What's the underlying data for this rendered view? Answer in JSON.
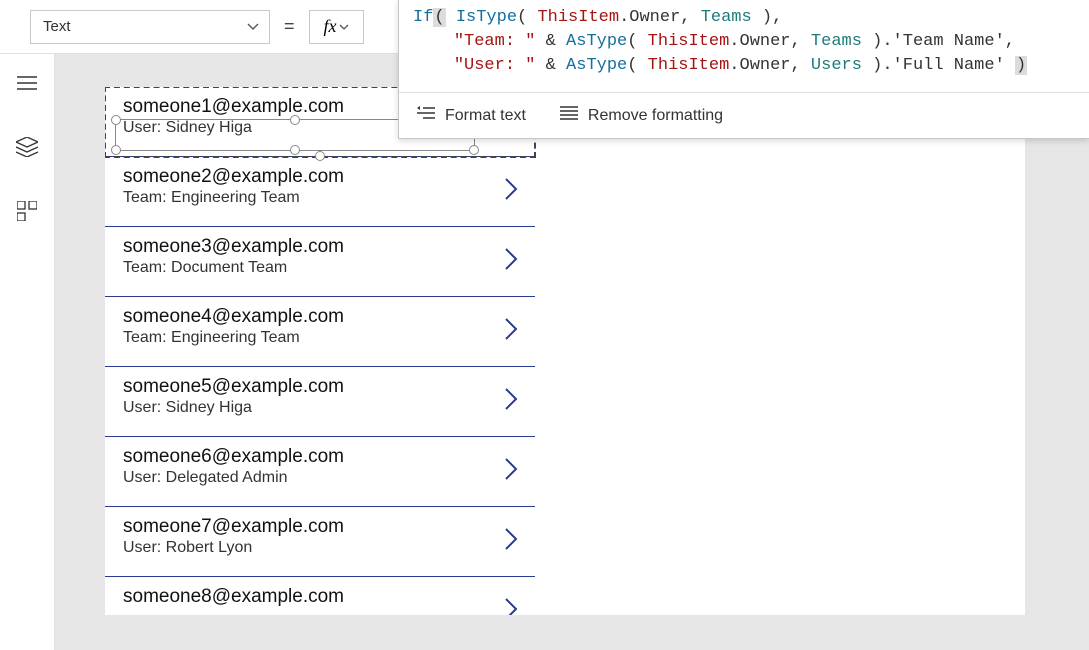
{
  "topbar": {
    "property": "Text",
    "equals": "=",
    "fx": "fx"
  },
  "formula": {
    "format_label": "Format text",
    "remove_label": "Remove formatting",
    "tokens": [
      {
        "t": "If",
        "c": "fn"
      },
      {
        "t": "(",
        "c": "par"
      },
      {
        "t": " ",
        "c": ""
      },
      {
        "t": "IsType",
        "c": "fn"
      },
      {
        "t": "( ",
        "c": ""
      },
      {
        "t": "ThisItem",
        "c": "kw"
      },
      {
        "t": ".",
        "c": ""
      },
      {
        "t": "Owner",
        "c": ""
      },
      {
        "t": ", ",
        "c": ""
      },
      {
        "t": "Teams",
        "c": "id"
      },
      {
        "t": " ),",
        "c": ""
      },
      {
        "t": "\n    ",
        "c": ""
      },
      {
        "t": "\"Team: \"",
        "c": "str"
      },
      {
        "t": " & ",
        "c": ""
      },
      {
        "t": "AsType",
        "c": "fn"
      },
      {
        "t": "( ",
        "c": ""
      },
      {
        "t": "ThisItem",
        "c": "kw"
      },
      {
        "t": ".",
        "c": ""
      },
      {
        "t": "Owner",
        "c": ""
      },
      {
        "t": ", ",
        "c": ""
      },
      {
        "t": "Teams",
        "c": "id"
      },
      {
        "t": " ).",
        "c": ""
      },
      {
        "t": "'Team Name'",
        "c": ""
      },
      {
        "t": ",",
        "c": ""
      },
      {
        "t": "\n    ",
        "c": ""
      },
      {
        "t": "\"User: \"",
        "c": "str"
      },
      {
        "t": " & ",
        "c": ""
      },
      {
        "t": "AsType",
        "c": "fn"
      },
      {
        "t": "( ",
        "c": ""
      },
      {
        "t": "ThisItem",
        "c": "kw"
      },
      {
        "t": ".",
        "c": ""
      },
      {
        "t": "Owner",
        "c": ""
      },
      {
        "t": ", ",
        "c": ""
      },
      {
        "t": "Users",
        "c": "id"
      },
      {
        "t": " ).",
        "c": ""
      },
      {
        "t": "'Full Name'",
        "c": ""
      },
      {
        "t": " ",
        "c": ""
      },
      {
        "t": ")",
        "c": "par"
      }
    ]
  },
  "gallery": {
    "items": [
      {
        "title": "someone1@example.com",
        "sub": "User: Sidney Higa",
        "selected": true
      },
      {
        "title": "someone2@example.com",
        "sub": "Team: Engineering Team"
      },
      {
        "title": "someone3@example.com",
        "sub": "Team: Document Team"
      },
      {
        "title": "someone4@example.com",
        "sub": "Team: Engineering Team"
      },
      {
        "title": "someone5@example.com",
        "sub": "User: Sidney Higa"
      },
      {
        "title": "someone6@example.com",
        "sub": "User: Delegated Admin"
      },
      {
        "title": "someone7@example.com",
        "sub": "User: Robert Lyon"
      },
      {
        "title": "someone8@example.com",
        "sub": ""
      }
    ]
  },
  "rail": {
    "items": [
      "hamburger",
      "layers",
      "components"
    ]
  }
}
